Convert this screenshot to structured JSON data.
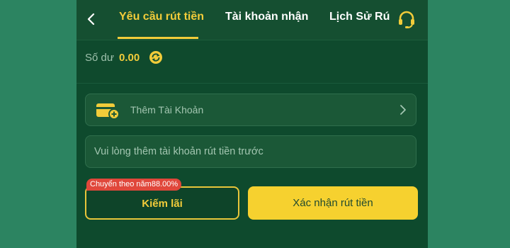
{
  "header": {
    "tabs": [
      {
        "label": "Yêu cầu rút tiền",
        "active": true
      },
      {
        "label": "Tài khoản nhận",
        "active": false
      },
      {
        "label": "Lịch Sử Rú",
        "active": false
      }
    ],
    "icons": {
      "back": "chevron-left-icon",
      "support": "headset-icon"
    }
  },
  "balance": {
    "label": "Số dư",
    "value": "0.00",
    "icon": "refresh-icon"
  },
  "account": {
    "add_label": "Thêm Tài Khoản",
    "notice": "Vui lòng thêm tài khoản rút tiền trước"
  },
  "actions": {
    "badge": "Chuyển theo năm88.00%",
    "earn_label": "Kiếm lãi",
    "confirm_label": "Xác nhận rút tiền"
  },
  "colors": {
    "accent": "#f2cc3a",
    "panel": "#0e4a2d",
    "background": "#2c8461",
    "badge": "#e0473b"
  }
}
